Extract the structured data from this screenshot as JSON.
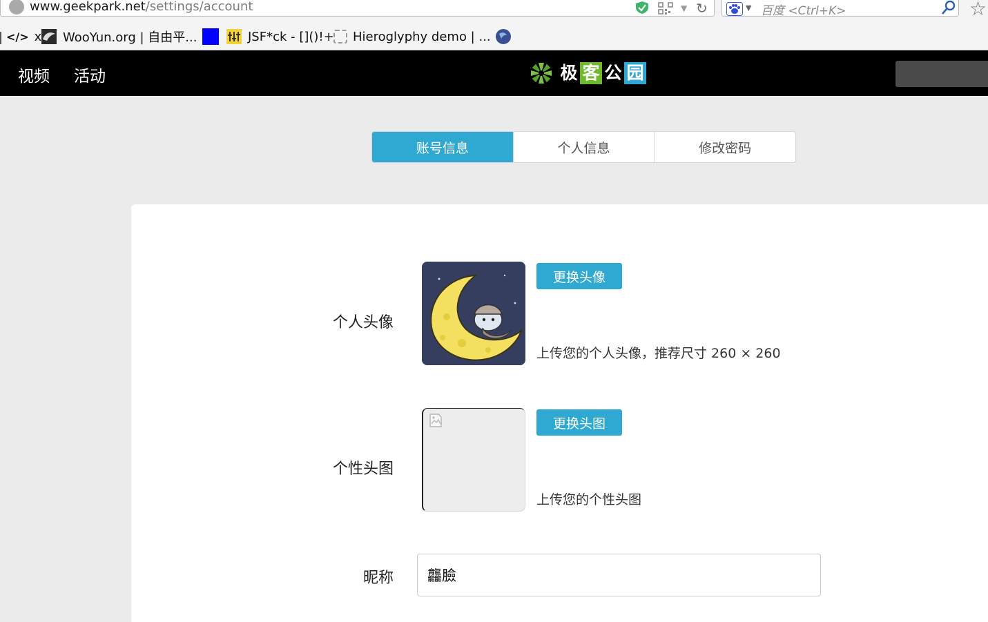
{
  "browser": {
    "url_host": "www.geekpark.net",
    "url_path": "/settings/account",
    "search_placeholder": "百度 <Ctrl+K>",
    "bookmarks": [
      {
        "label": "x",
        "icon": "code-icon"
      },
      {
        "label": "WooYun.org | 自由平...",
        "icon": "wooyun-icon"
      },
      {
        "label": "",
        "icon": "blue-square-icon"
      },
      {
        "label": "JSF*ck - []()!+",
        "icon": "jsfuck-icon"
      },
      {
        "label": "Hieroglyphy demo | ...",
        "icon": "dotted-square-icon"
      },
      {
        "label": "",
        "icon": "globe-icon"
      }
    ]
  },
  "header": {
    "nav": [
      "视频",
      "活动"
    ],
    "logo_chars": [
      "极",
      "客",
      "公",
      "园"
    ],
    "logo_colors": [
      "#000000",
      "#6fb92c",
      "#000000",
      "#2fa6d4"
    ]
  },
  "tabs": [
    {
      "label": "账号信息",
      "active": true
    },
    {
      "label": "个人信息",
      "active": false
    },
    {
      "label": "修改密码",
      "active": false
    }
  ],
  "form": {
    "avatar": {
      "label": "个人头像",
      "button": "更换头像",
      "hint": "上传您的个人头像，推荐尺寸 260 × 260"
    },
    "cover": {
      "label": "个性头图",
      "button": "更换头图",
      "hint": "上传您的个性头图"
    },
    "nickname": {
      "label": "昵称",
      "value": "龘臉"
    }
  },
  "colors": {
    "accent": "#30a9d2",
    "header_bg": "#000000",
    "page_bg": "#ebebeb"
  }
}
